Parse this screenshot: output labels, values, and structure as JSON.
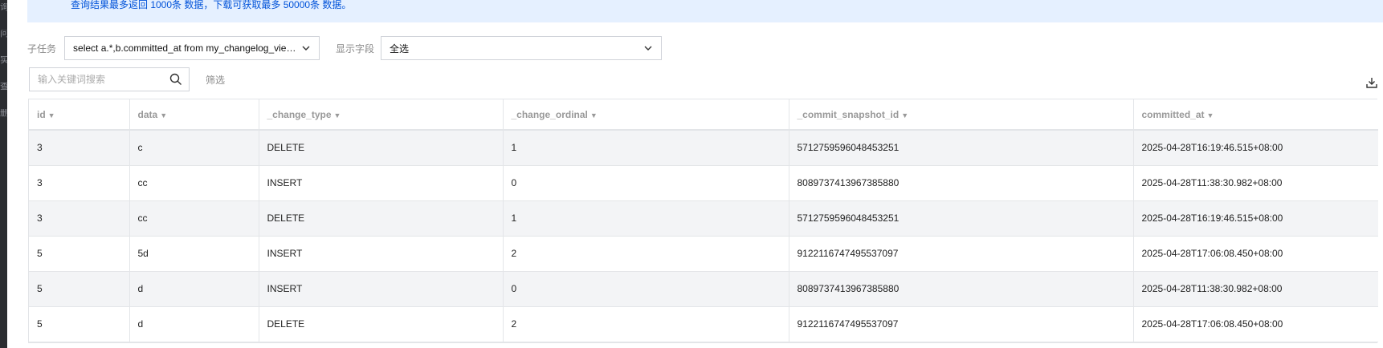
{
  "left_strip": [
    "询",
    "问",
    "实",
    "查",
    "删"
  ],
  "notice": "查询结果最多返回 1000条 数据，下载可获取最多 50000条 数据。",
  "subtask": {
    "label": "子任务",
    "value": "select a.*,b.committed_at from my_changelog_view a joi..."
  },
  "fields": {
    "label": "显示字段",
    "value": "全选"
  },
  "search": {
    "placeholder": "输入关键词搜索"
  },
  "filter_label": "筛选",
  "table": {
    "columns": [
      "id",
      "data",
      "_change_type",
      "_change_ordinal",
      "_commit_snapshot_id",
      "committed_at"
    ],
    "rows": [
      [
        "3",
        "c",
        "DELETE",
        "1",
        "5712759596048453251",
        "2025-04-28T16:19:46.515+08:00"
      ],
      [
        "3",
        "cc",
        "INSERT",
        "0",
        "8089737413967385880",
        "2025-04-28T11:38:30.982+08:00"
      ],
      [
        "3",
        "cc",
        "DELETE",
        "1",
        "5712759596048453251",
        "2025-04-28T16:19:46.515+08:00"
      ],
      [
        "5",
        "5d",
        "INSERT",
        "2",
        "9122116747495537097",
        "2025-04-28T17:06:08.450+08:00"
      ],
      [
        "5",
        "d",
        "INSERT",
        "0",
        "8089737413967385880",
        "2025-04-28T11:38:30.982+08:00"
      ],
      [
        "5",
        "d",
        "DELETE",
        "2",
        "9122116747495537097",
        "2025-04-28T17:06:08.450+08:00"
      ]
    ]
  },
  "colors": {
    "notice_bg": "#e5f0ff",
    "notice_text": "#0052d9",
    "row_stripe": "#f3f4f6"
  }
}
